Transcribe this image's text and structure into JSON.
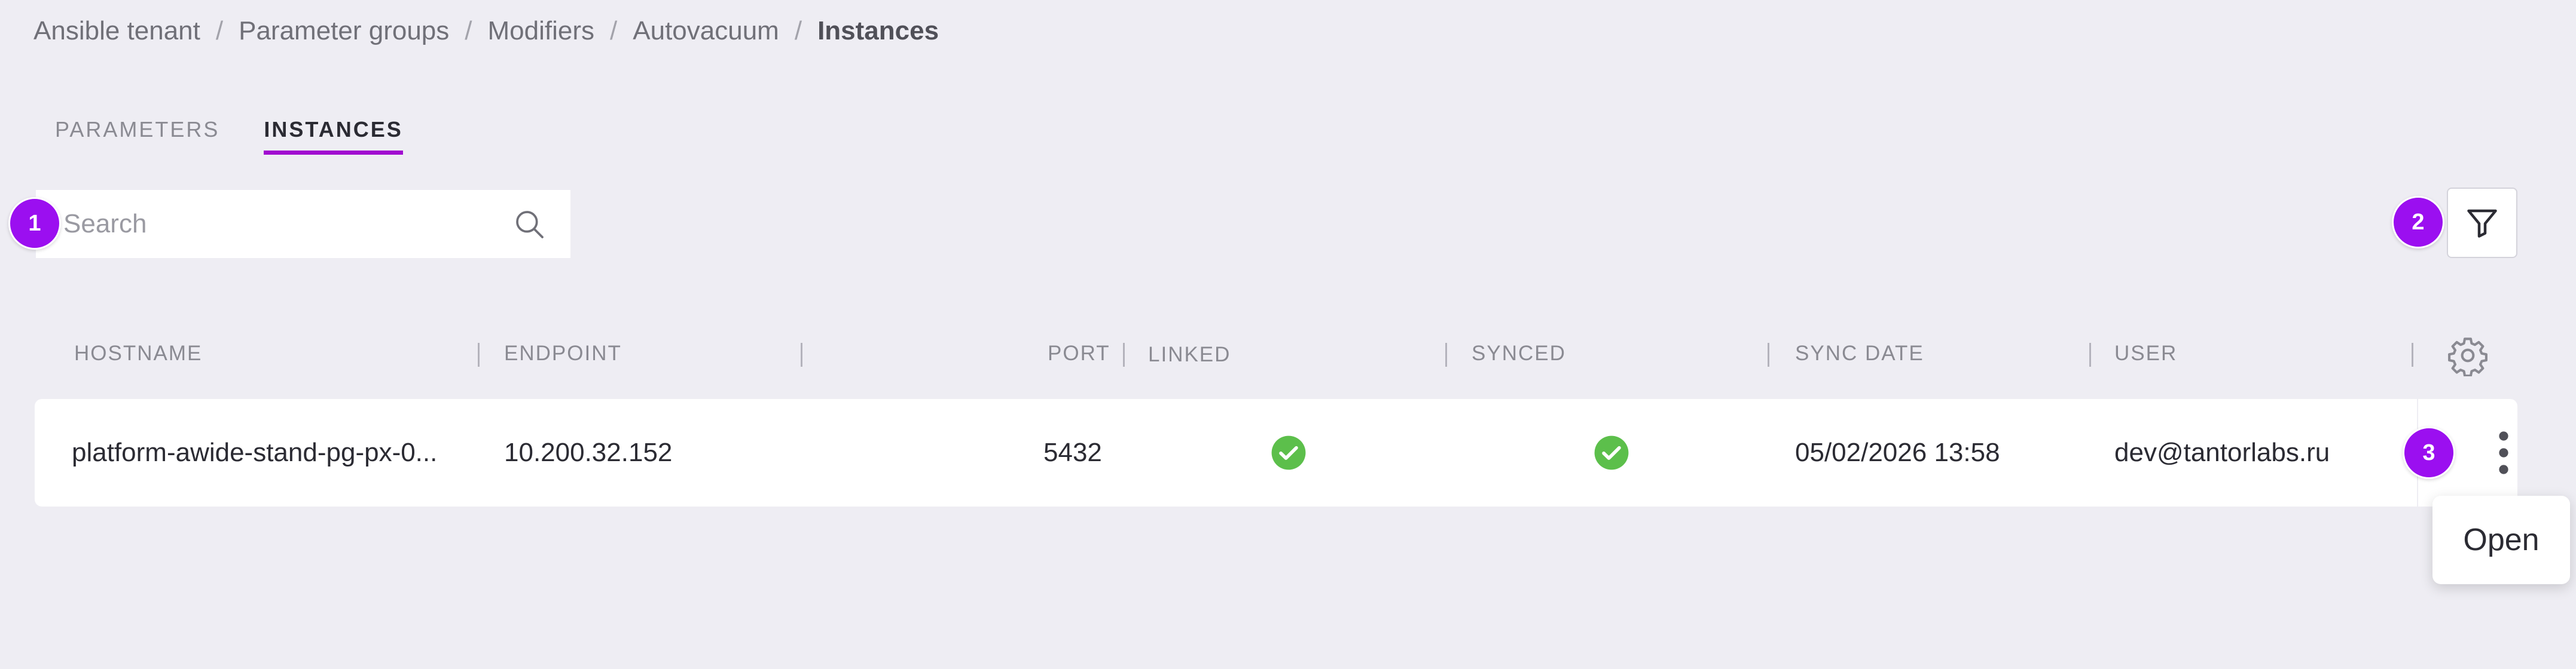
{
  "breadcrumb": {
    "items": [
      "Ansible tenant",
      "Parameter groups",
      "Modifiers",
      "Autovacuum",
      "Instances"
    ],
    "separator": "/"
  },
  "tabs": [
    {
      "label": "PARAMETERS",
      "active": false
    },
    {
      "label": "INSTANCES",
      "active": true
    }
  ],
  "search": {
    "placeholder": "Search",
    "value": "",
    "icon": "search-icon"
  },
  "markers": [
    "1",
    "2",
    "3"
  ],
  "filter": {
    "icon": "filter-icon"
  },
  "table": {
    "columns": [
      "HOSTNAME",
      "ENDPOINT",
      "",
      "PORT",
      "LINKED",
      "SYNCED",
      "SYNC DATE",
      "USER"
    ],
    "settings_icon": "gear-icon",
    "rows": [
      {
        "hostname": "platform-awide-stand-pg-px-0...",
        "endpoint": "10.200.32.152",
        "port": "5432",
        "linked": true,
        "synced": true,
        "sync_date": "05/02/2026 13:58",
        "user": "dev@tantorlabs.ru",
        "actions_icon": "kebab-menu-icon"
      }
    ]
  },
  "context_menu": {
    "items": [
      "Open"
    ]
  },
  "colors": {
    "background": "#eeedf3",
    "accent": "#a10bd0",
    "marker": "#9b0ff0",
    "success": "#5cbf4b"
  }
}
